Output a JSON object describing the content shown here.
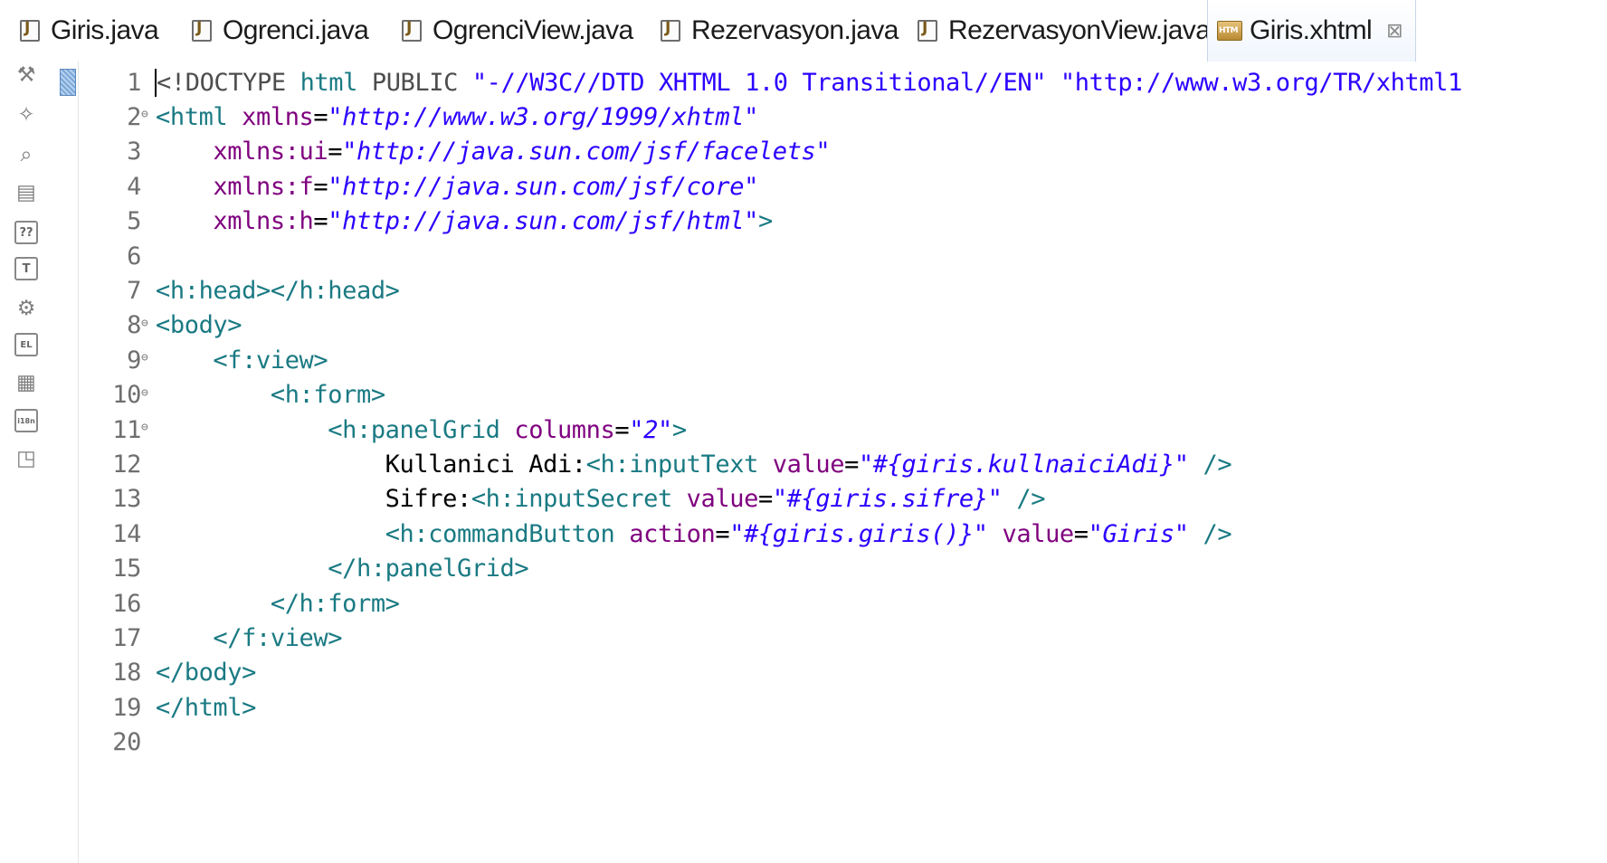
{
  "tabs": [
    {
      "label": "Giris.java",
      "icon": "java-file-icon",
      "active": false
    },
    {
      "label": "Ogrenci.java",
      "icon": "java-file-icon",
      "active": false
    },
    {
      "label": "OgrenciView.java",
      "icon": "java-file-icon",
      "active": false
    },
    {
      "label": "Rezervasyon.java",
      "icon": "java-file-icon",
      "active": false
    },
    {
      "label": "RezervasyonView.java",
      "icon": "java-file-icon",
      "active": false
    },
    {
      "label": "Giris.xhtml",
      "icon": "html-file-icon",
      "active": true
    }
  ],
  "tab_close_glyph": "⊠",
  "palette": [
    "tools-icon",
    "wand-icon",
    "find-icon",
    "snippet-icon",
    "help-icon",
    "text-icon",
    "font-icon",
    "el-icon",
    "grid-icon",
    "i18n-icon",
    "panel-icon"
  ],
  "palette_labels": {
    "help": "??",
    "text": "T",
    "el": "EL",
    "i18n": "i18n"
  },
  "colors": {
    "tag": "#1a7a83",
    "attribute": "#7f007f",
    "value": "#2a00ff",
    "text": "#000000",
    "line_number": "#6f6f6f"
  },
  "lines": [
    {
      "n": "1",
      "fold": false,
      "parts": [
        [
          "dt",
          "<!DOCTYPE "
        ],
        [
          "tag",
          "html"
        ],
        [
          "dt",
          " PUBLIC "
        ],
        [
          "val2",
          "\"-//W3C//DTD XHTML 1.0 Transitional//EN\" \"http://www.w3.org/TR/xhtml1"
        ]
      ]
    },
    {
      "n": "2",
      "fold": true,
      "parts": [
        [
          "tag",
          "<html "
        ],
        [
          "attr",
          "xmlns"
        ],
        [
          "txt",
          "="
        ],
        [
          "val",
          "\"http://www.w3.org/1999/xhtml\""
        ]
      ]
    },
    {
      "n": "3",
      "fold": false,
      "parts": [
        [
          "txt",
          "    "
        ],
        [
          "attr",
          "xmlns:ui"
        ],
        [
          "txt",
          "="
        ],
        [
          "val",
          "\"http://java.sun.com/jsf/facelets\""
        ]
      ]
    },
    {
      "n": "4",
      "fold": false,
      "parts": [
        [
          "txt",
          "    "
        ],
        [
          "attr",
          "xmlns:f"
        ],
        [
          "txt",
          "="
        ],
        [
          "val",
          "\"http://java.sun.com/jsf/core\""
        ]
      ]
    },
    {
      "n": "5",
      "fold": false,
      "parts": [
        [
          "txt",
          "    "
        ],
        [
          "attr",
          "xmlns:h"
        ],
        [
          "txt",
          "="
        ],
        [
          "val",
          "\"http://java.sun.com/jsf/html\""
        ],
        [
          "tag",
          ">"
        ]
      ]
    },
    {
      "n": "6",
      "fold": false,
      "parts": []
    },
    {
      "n": "7",
      "fold": false,
      "parts": [
        [
          "tag",
          "<h:head></h:head>"
        ]
      ]
    },
    {
      "n": "8",
      "fold": true,
      "parts": [
        [
          "tag",
          "<body>"
        ]
      ]
    },
    {
      "n": "9",
      "fold": true,
      "parts": [
        [
          "txt",
          "    "
        ],
        [
          "tag",
          "<f:view>"
        ]
      ]
    },
    {
      "n": "10",
      "fold": true,
      "parts": [
        [
          "txt",
          "        "
        ],
        [
          "tag",
          "<h:form>"
        ]
      ]
    },
    {
      "n": "11",
      "fold": true,
      "parts": [
        [
          "txt",
          "            "
        ],
        [
          "tag",
          "<h:panelGrid "
        ],
        [
          "attr",
          "columns"
        ],
        [
          "txt",
          "="
        ],
        [
          "val",
          "\"2\""
        ],
        [
          "tag",
          ">"
        ]
      ]
    },
    {
      "n": "12",
      "fold": false,
      "parts": [
        [
          "txt",
          "                Kullanici Adi:"
        ],
        [
          "tag",
          "<h:inputText "
        ],
        [
          "attr",
          "value"
        ],
        [
          "txt",
          "="
        ],
        [
          "val",
          "\"#{giris.kullnaiciAdi}\""
        ],
        [
          "tag",
          " />"
        ]
      ]
    },
    {
      "n": "13",
      "fold": false,
      "parts": [
        [
          "txt",
          "                Sifre:"
        ],
        [
          "tag",
          "<h:inputSecret "
        ],
        [
          "attr",
          "value"
        ],
        [
          "txt",
          "="
        ],
        [
          "val",
          "\"#{giris.sifre}\""
        ],
        [
          "tag",
          " />"
        ]
      ]
    },
    {
      "n": "14",
      "fold": false,
      "parts": [
        [
          "txt",
          "                "
        ],
        [
          "tag",
          "<h:commandButton "
        ],
        [
          "attr",
          "action"
        ],
        [
          "txt",
          "="
        ],
        [
          "val",
          "\"#{giris.giris()}\""
        ],
        [
          "txt",
          " "
        ],
        [
          "attr",
          "value"
        ],
        [
          "txt",
          "="
        ],
        [
          "val",
          "\"Giris\""
        ],
        [
          "tag",
          " />"
        ]
      ]
    },
    {
      "n": "15",
      "fold": false,
      "parts": [
        [
          "txt",
          "            "
        ],
        [
          "tag",
          "</h:panelGrid>"
        ]
      ]
    },
    {
      "n": "16",
      "fold": false,
      "parts": [
        [
          "txt",
          "        "
        ],
        [
          "tag",
          "</h:form>"
        ]
      ]
    },
    {
      "n": "17",
      "fold": false,
      "parts": [
        [
          "txt",
          "    "
        ],
        [
          "tag",
          "</f:view>"
        ]
      ]
    },
    {
      "n": "18",
      "fold": false,
      "parts": [
        [
          "tag",
          "</body>"
        ]
      ]
    },
    {
      "n": "19",
      "fold": false,
      "parts": [
        [
          "tag",
          "</html>"
        ]
      ]
    },
    {
      "n": "20",
      "fold": false,
      "parts": []
    }
  ]
}
